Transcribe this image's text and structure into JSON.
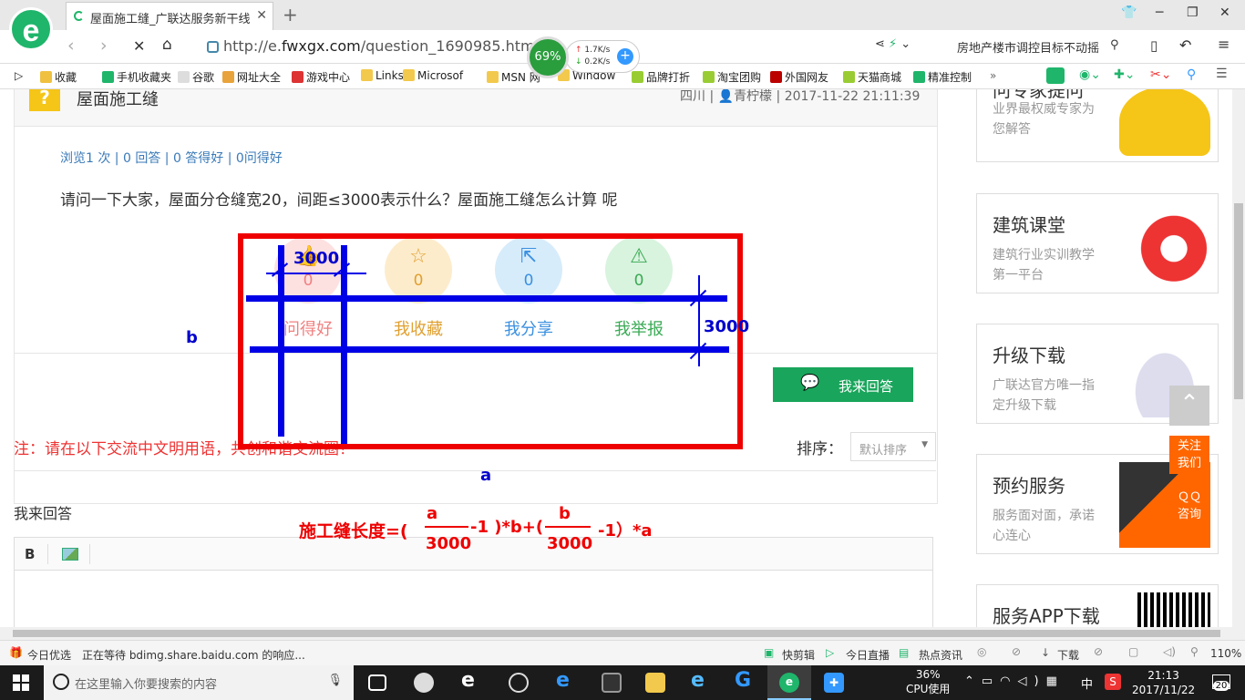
{
  "browser": {
    "tab_title": "屋面施工缝_广联达服务新干线",
    "new_tab_symbol": "+",
    "url_prefix": "http://e.",
    "url_domain": "fwxgx.com",
    "url_path": "/question_1690985.html",
    "cpu_ball": "69%",
    "net_up": "1.7K/s",
    "net_down": "0.2K/s",
    "search_text": "房地产楼市调控目标不动摇"
  },
  "favorites": [
    "收藏",
    "手机收藏夹",
    "谷歌",
    "网址大全",
    "游戏中心",
    "Links",
    "Microsof",
    "MSN 网",
    "Window",
    "品牌打折",
    "淘宝团购",
    "外国网友",
    "天猫商城",
    "精准控制"
  ],
  "question": {
    "title": "屋面施工缝",
    "meta_region": "四川",
    "meta_user": "青柠檬",
    "meta_time": "2017-11-22 21:11:39",
    "stats": "浏览1 次 | 0 回答 | 0 答得好 | 0问得好",
    "body": "请问一下大家，屋面分仓缝宽20，间距≤3000表示什么？屋面施工缝怎么计算 呢",
    "actions": [
      {
        "label": "问得好",
        "count": "0",
        "color": "#f08080",
        "bg": "#fde0e0"
      },
      {
        "label": "我收藏",
        "count": "0",
        "color": "#e0a030",
        "bg": "#fdeccc"
      },
      {
        "label": "我分享",
        "count": "0",
        "color": "#3a90e0",
        "bg": "#d6ecfb"
      },
      {
        "label": "我举报",
        "count": "0",
        "color": "#3aaa55",
        "bg": "#d8f3de"
      }
    ],
    "answer_button": "我来回答"
  },
  "notice": "注：请在以下交流中文明用语，共创和谐交流圈！",
  "sort": {
    "label": "排序：",
    "value": "默认排序"
  },
  "answer_section": {
    "title": "我来回答",
    "bold": "B"
  },
  "annotation": {
    "dim_top": "3000",
    "dim_right": "3000",
    "label_b": "b",
    "label_a": "a",
    "formula_prefix": "施工缝长度=(",
    "f1_num": "a",
    "f1_den": "3000",
    "f1_mid": "-1 )*b+(",
    "f2_num": "b",
    "f2_den": "3000",
    "f2_tail": "-1）*a"
  },
  "sidebar": [
    {
      "title": "问专家提问",
      "desc": "业界最权威专家为您解答"
    },
    {
      "title": "建筑课堂",
      "desc": "建筑行业实训教学第一平台"
    },
    {
      "title": "升级下载",
      "desc": "广联达官方唯一指定升级下载"
    },
    {
      "title": "预约服务",
      "desc": "服务面对面，承诺心连心"
    },
    {
      "title": "服务APP下载",
      "desc": ""
    }
  ],
  "float": {
    "follow": "关注我们",
    "qq": "ＱＱ咨询"
  },
  "status": {
    "left1": "今日优选",
    "left2": "正在等待 bdimg.share.baidu.com 的响应...",
    "items": [
      "快剪辑",
      "今日直播",
      "热点资讯",
      "下载"
    ],
    "zoom": "110%"
  },
  "taskbar": {
    "search_placeholder": "在这里输入你要搜索的内容",
    "cpu": "36%",
    "cpu_label": "CPU使用",
    "ime": "中",
    "time": "21:13",
    "date": "2017/11/22",
    "notif": "20"
  }
}
